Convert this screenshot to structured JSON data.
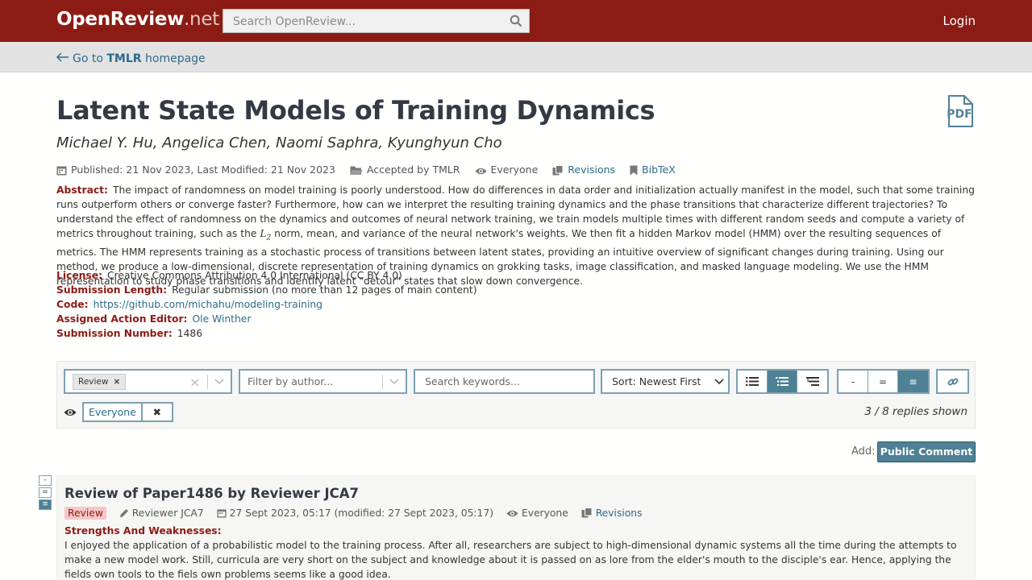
{
  "header": {
    "logo_main": "OpenReview",
    "logo_suffix": ".net",
    "search_placeholder": "Search OpenReview...",
    "login": "Login"
  },
  "subbar": {
    "back_prefix": "Go to ",
    "back_venue": "TMLR",
    "back_suffix": " homepage"
  },
  "paper": {
    "title": "Latent State Models of Training Dynamics",
    "authors": "Michael Y. Hu, Angelica Chen, Naomi Saphra, Kyunghyun Cho",
    "pdf_label": "PDF",
    "meta": {
      "dates": "Published: 21 Nov 2023, Last Modified: 21 Nov 2023",
      "venue": "Accepted by TMLR",
      "readers": "Everyone",
      "revisions": "Revisions",
      "bibtex": "BibTeX"
    },
    "abstract_label": "Abstract:",
    "abstract_1": "The impact of randomness on model training is poorly understood. How do differences in data order and initialization actually manifest in the model, such that some training runs outperform others or converge faster? Furthermore, how can we interpret the resulting training dynamics and the phase transitions that characterize different trajectories? To understand the effect of randomness on the dynamics and outcomes of neural network training, we train models multiple times with different random seeds and compute a variety of metrics throughout training, such as the ",
    "abstract_norm": "L",
    "abstract_norm_sub": "2",
    "abstract_2": " norm, mean, and variance of the neural network's weights. We then fit a hidden Markov model (HMM) over the resulting sequences of metrics. The HMM represents training as a stochastic process of transitions between latent states, providing an intuitive overview of significant changes during training. Using our method, we produce a low-dimensional, discrete representation of training dynamics on grokking tasks, image classification, and masked language modeling. We use the HMM representation to study phase transitions and identify latent \"detour\" states that slow down convergence.",
    "license_label": "License:",
    "license": "Creative Commons Attribution 4.0 International (CC BY 4.0)",
    "length_label": "Submission Length:",
    "length": "Regular submission (no more than 12 pages of main content)",
    "code_label": "Code:",
    "code": "https://github.com/michahu/modeling-training",
    "editor_label": "Assigned Action Editor:",
    "editor": "Ole Winther",
    "number_label": "Submission Number:",
    "number": "1486"
  },
  "filters": {
    "invitation_chip": "Review",
    "author_placeholder": "Filter by author...",
    "keyword_placeholder": "Search keywords...",
    "sort_value": "Sort: Newest First",
    "collapse_buttons": [
      "-",
      "=",
      "≡"
    ],
    "readers_tag": "Everyone",
    "replies_shown": "3 / 8 replies shown"
  },
  "add": {
    "label": "Add:",
    "button": "Public Comment"
  },
  "review": {
    "side_buttons": [
      "-",
      "=",
      "≡"
    ],
    "title": "Review of Paper1486 by Reviewer JCA7",
    "badge": "Review",
    "signature": "Reviewer JCA7",
    "date": "27 Sept 2023, 05:17 (modified: 27 Sept 2023, 05:17)",
    "readers": "Everyone",
    "revisions": "Revisions",
    "section_label": "Strengths And Weaknesses:",
    "body": "I enjoyed the application of a probabilistic model to the training process. After all, researchers are subject to high-dimensional dynamic systems all the time during the attempts to make a new model work. Still, curricula are very short on the subject and knowledge about it is passed on as lore from the elder's mouth to the disciple's ear. Hence, applying the fields own tools to the fiels own problems seems like a good idea."
  },
  "colors": {
    "brand_red": "#8c1b13",
    "link_blue": "#2c6b8c",
    "button_teal": "#4f8195"
  }
}
